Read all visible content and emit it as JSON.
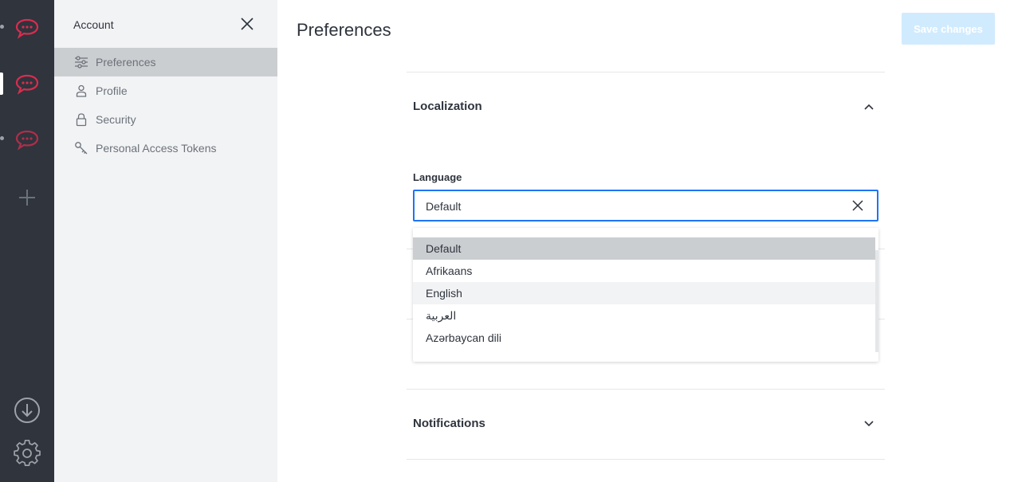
{
  "colors": {
    "rail_bg": "#2f343d",
    "sidebar_bg": "#f2f3f5",
    "active_item_bg": "#cbced1",
    "accent": "#1d74f5",
    "brand_red": "#db2c4e",
    "save_btn_bg": "#d1ebfe"
  },
  "rail": {
    "servers": [
      {
        "name": "server-1",
        "icon": "rocketchat-logo"
      },
      {
        "name": "server-2",
        "icon": "rocketchat-logo"
      },
      {
        "name": "server-3",
        "icon": "rocketchat-logo"
      }
    ],
    "add_icon": "plus-icon",
    "download_icon": "download-icon",
    "settings_icon": "gear-icon"
  },
  "sidebar": {
    "title": "Account",
    "close_icon": "close-icon",
    "items": [
      {
        "label": "Preferences",
        "icon": "sliders-icon"
      },
      {
        "label": "Profile",
        "icon": "user-icon"
      },
      {
        "label": "Security",
        "icon": "lock-icon"
      },
      {
        "label": "Personal Access Tokens",
        "icon": "key-icon"
      }
    ]
  },
  "main": {
    "title": "Preferences",
    "save_label": "Save changes",
    "localization": {
      "title": "Localization",
      "language_label": "Language",
      "language_value": "Default",
      "options": [
        "Default",
        "Afrikaans",
        "English",
        "العربية",
        "Azərbaycan dili"
      ]
    },
    "notifications": {
      "title": "Notifications"
    }
  }
}
